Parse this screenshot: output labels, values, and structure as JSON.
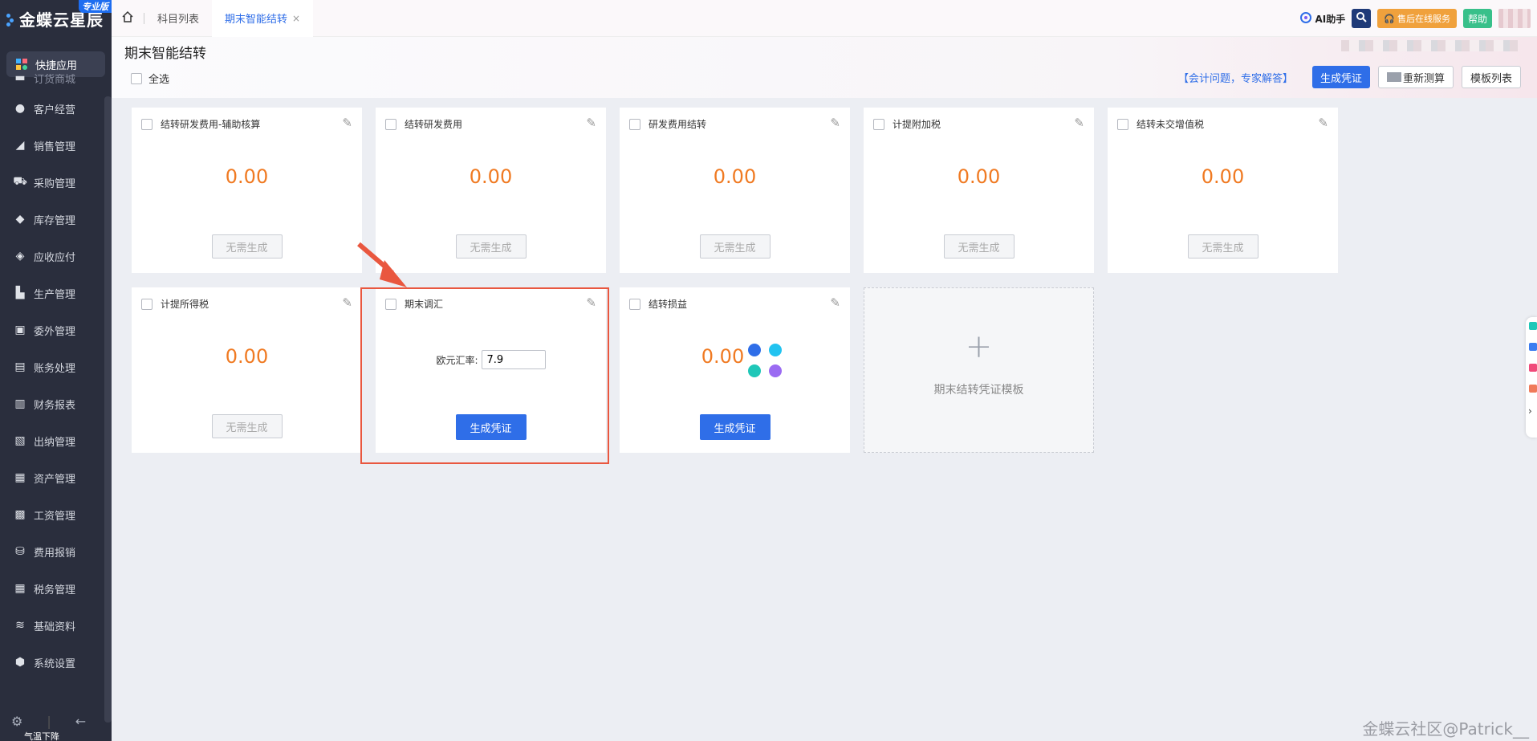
{
  "app": {
    "brand": "金蝶云星辰",
    "edition": "专业版"
  },
  "sidebar": {
    "items": [
      {
        "label": "快捷应用",
        "icon": "grid-apps-icon"
      },
      {
        "label": "订货商城",
        "icon": "store-icon"
      },
      {
        "label": "客户经营",
        "icon": "customer-icon"
      },
      {
        "label": "销售管理",
        "icon": "sales-icon"
      },
      {
        "label": "采购管理",
        "icon": "cart-icon"
      },
      {
        "label": "库存管理",
        "icon": "box-icon"
      },
      {
        "label": "应收应付",
        "icon": "receivable-icon"
      },
      {
        "label": "生产管理",
        "icon": "factory-icon"
      },
      {
        "label": "委外管理",
        "icon": "outsource-icon"
      },
      {
        "label": "账务处理",
        "icon": "ledger-icon"
      },
      {
        "label": "财务报表",
        "icon": "report-icon"
      },
      {
        "label": "出纳管理",
        "icon": "cashier-icon"
      },
      {
        "label": "资产管理",
        "icon": "asset-icon"
      },
      {
        "label": "工资管理",
        "icon": "salary-icon"
      },
      {
        "label": "费用报销",
        "icon": "expense-icon"
      },
      {
        "label": "税务管理",
        "icon": "tax-icon"
      },
      {
        "label": "基础资料",
        "icon": "layers-icon"
      },
      {
        "label": "系统设置",
        "icon": "settings-icon"
      }
    ],
    "bottom_notice": "气温下降"
  },
  "tabs": [
    {
      "label": "科目列表"
    },
    {
      "label": "期末智能结转",
      "close": "×"
    }
  ],
  "top_right": {
    "ai_label": "AI助手",
    "service_label": "售后在线服务",
    "help_label": "帮助"
  },
  "page": {
    "title": "期末智能结转",
    "select_all": "全选",
    "consult_link": "【会计问题，专家解答】",
    "generate_voucher": "生成凭证",
    "recalc": "重新测算",
    "template_list": "模板列表"
  },
  "cards": [
    {
      "title": "结转研发费用-辅助核算",
      "amount": "0.00",
      "action": "无需生成"
    },
    {
      "title": "结转研发费用",
      "amount": "0.00",
      "action": "无需生成"
    },
    {
      "title": "研发费用结转",
      "amount": "0.00",
      "action": "无需生成"
    },
    {
      "title": "计提附加税",
      "amount": "0.00",
      "action": "无需生成"
    },
    {
      "title": "结转未交增值税",
      "amount": "0.00",
      "action": "无需生成"
    },
    {
      "title": "计提所得税",
      "amount": "0.00",
      "action": "无需生成"
    },
    {
      "title": "期末调汇",
      "rate_label": "欧元汇率:",
      "rate_value": "7.9",
      "action": "生成凭证"
    },
    {
      "title": "结转损益",
      "amount": "0.00",
      "action": "生成凭证"
    }
  ],
  "add_template": {
    "plus": "+",
    "label": "期末结转凭证模板"
  },
  "watermark": "金蝶云社区@Patrick__",
  "colors": {
    "primary": "#2f6ee8",
    "amount": "#f07a22",
    "highlight": "#e9573f",
    "sidebar": "#2a2e3d"
  }
}
